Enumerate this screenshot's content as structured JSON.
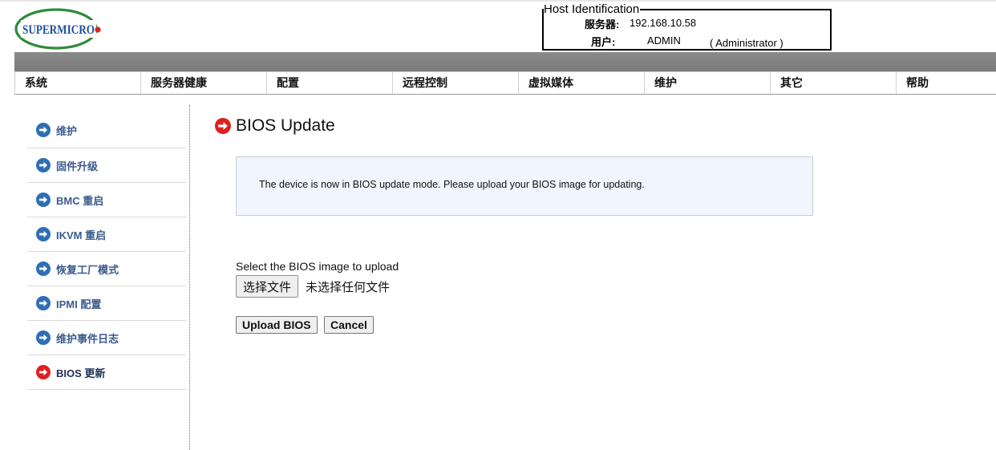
{
  "brand": {
    "logo_text": "SUPERMICRO",
    "logo_color": "#1d4fa0",
    "logo_swoosh_color": "#2e8b3a"
  },
  "host": {
    "legend": "Host Identification",
    "server_label": "服务器:",
    "server_value": "192.168.10.58",
    "user_label": "用户:",
    "user_value": "ADMIN",
    "user_role": "( Administrator )"
  },
  "nav": {
    "items": [
      "系统",
      "服务器健康",
      "配置",
      "远程控制",
      "虚拟媒体",
      "维护",
      "其它",
      "帮助"
    ]
  },
  "sidebar": {
    "items": [
      {
        "label": "维护",
        "icon": "arrow-right-circle-icon",
        "color": "#2f6db5"
      },
      {
        "label": "固件升级",
        "icon": "arrow-right-circle-icon",
        "color": "#2f6db5"
      },
      {
        "label": "BMC 重启",
        "icon": "arrow-right-circle-icon",
        "color": "#2f6db5"
      },
      {
        "label": "IKVM 重启",
        "icon": "arrow-right-circle-icon",
        "color": "#2f6db5"
      },
      {
        "label": "恢复工厂模式",
        "icon": "arrow-right-circle-icon",
        "color": "#2f6db5"
      },
      {
        "label": "IPMI 配置",
        "icon": "arrow-right-circle-icon",
        "color": "#2f6db5"
      },
      {
        "label": "维护事件日志",
        "icon": "arrow-right-circle-icon",
        "color": "#2f6db5"
      },
      {
        "label": "BIOS 更新",
        "icon": "arrow-right-circle-icon",
        "color": "#e01f1f",
        "active": true
      }
    ]
  },
  "main": {
    "title": "BIOS Update",
    "notice": "The device is now in BIOS update mode. Please upload your BIOS image for updating.",
    "upload_label": "Select the BIOS image to upload",
    "file_button": "选择文件",
    "file_status": "未选择任何文件",
    "upload_button": "Upload BIOS",
    "cancel_button": "Cancel"
  }
}
